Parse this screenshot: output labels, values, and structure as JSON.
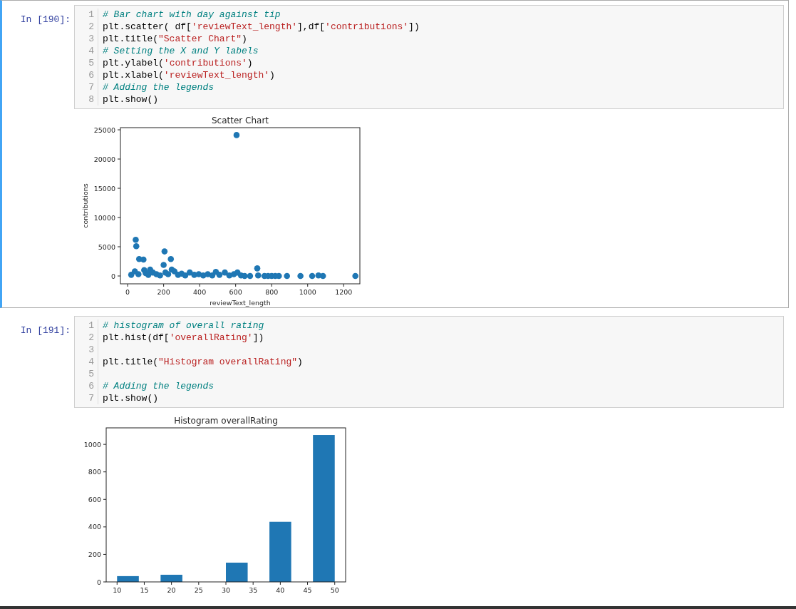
{
  "cells": [
    {
      "prompt": "In [190]:",
      "selected": true,
      "code": [
        {
          "number": "1",
          "tokens": [
            {
              "kind": "comment",
              "text": "# Bar chart with day against tip"
            }
          ]
        },
        {
          "number": "2",
          "tokens": [
            {
              "kind": "plain",
              "text": "plt.scatter( df["
            },
            {
              "kind": "string",
              "text": "'reviewText_length'"
            },
            {
              "kind": "plain",
              "text": "],df["
            },
            {
              "kind": "string",
              "text": "'contributions'"
            },
            {
              "kind": "plain",
              "text": "])"
            }
          ]
        },
        {
          "number": "3",
          "tokens": [
            {
              "kind": "plain",
              "text": "plt.title("
            },
            {
              "kind": "string",
              "text": "\"Scatter Chart\""
            },
            {
              "kind": "plain",
              "text": ")"
            }
          ]
        },
        {
          "number": "4",
          "tokens": [
            {
              "kind": "comment",
              "text": "# Setting the X and Y labels"
            }
          ]
        },
        {
          "number": "5",
          "tokens": [
            {
              "kind": "plain",
              "text": "plt.ylabel("
            },
            {
              "kind": "string",
              "text": "'contributions'"
            },
            {
              "kind": "plain",
              "text": ")"
            }
          ]
        },
        {
          "number": "6",
          "tokens": [
            {
              "kind": "plain",
              "text": "plt.xlabel("
            },
            {
              "kind": "string",
              "text": "'reviewText_length'"
            },
            {
              "kind": "plain",
              "text": ")"
            }
          ]
        },
        {
          "number": "7",
          "tokens": [
            {
              "kind": "comment",
              "text": "# Adding the legends"
            }
          ]
        },
        {
          "number": "8",
          "tokens": [
            {
              "kind": "plain",
              "text": "plt.show()"
            }
          ]
        }
      ],
      "output": {
        "chart_data": {
          "type": "scatter",
          "title": "Scatter Chart",
          "xlabel": "reviewText_length",
          "ylabel": "contributions",
          "xlim": [
            -40,
            1290
          ],
          "ylim": [
            -1340,
            25370
          ],
          "xticks": [
            0,
            200,
            400,
            600,
            800,
            1000,
            1200
          ],
          "yticks": [
            0,
            5000,
            10000,
            15000,
            20000,
            25000
          ],
          "x": [
            20,
            40,
            45,
            48,
            60,
            64,
            88,
            92,
            100,
            115,
            125,
            140,
            160,
            180,
            200,
            205,
            210,
            225,
            240,
            245,
            260,
            280,
            300,
            320,
            345,
            370,
            395,
            420,
            445,
            470,
            490,
            510,
            540,
            565,
            590,
            605,
            610,
            630,
            650,
            680,
            720,
            725,
            760,
            780,
            800,
            820,
            840,
            885,
            960,
            1025,
            1060,
            1085,
            1265
          ],
          "series": [
            {
              "color": "#1f77b4",
              "values": [
                200,
                800,
                6200,
                5100,
                300,
                2900,
                2800,
                1000,
                500,
                200,
                1100,
                600,
                300,
                100,
                1900,
                4200,
                600,
                300,
                2900,
                1100,
                800,
                200,
                400,
                100,
                600,
                200,
                300,
                100,
                300,
                100,
                700,
                200,
                600,
                100,
                300,
                24100,
                600,
                100,
                0,
                0,
                1300,
                100,
                0,
                0,
                0,
                0,
                0,
                0,
                0,
                0,
                100,
                0,
                0
              ]
            }
          ]
        }
      }
    },
    {
      "prompt": "In [191]:",
      "selected": false,
      "code": [
        {
          "number": "1",
          "tokens": [
            {
              "kind": "comment",
              "text": "# histogram of overall rating"
            }
          ]
        },
        {
          "number": "2",
          "tokens": [
            {
              "kind": "plain",
              "text": "plt.hist(df["
            },
            {
              "kind": "string",
              "text": "'overallRating'"
            },
            {
              "kind": "plain",
              "text": "])"
            }
          ]
        },
        {
          "number": "3"
        },
        {
          "number": "4",
          "tokens": [
            {
              "kind": "plain",
              "text": "plt.title("
            },
            {
              "kind": "string",
              "text": "\"Histogram overallRating\""
            },
            {
              "kind": "plain",
              "text": ")"
            }
          ]
        },
        {
          "number": "5"
        },
        {
          "number": "6",
          "tokens": [
            {
              "kind": "comment",
              "text": "# Adding the legends"
            }
          ]
        },
        {
          "number": "7",
          "tokens": [
            {
              "kind": "plain",
              "text": "plt.show()"
            }
          ]
        }
      ],
      "output": {
        "chart_data": {
          "type": "bar",
          "title": "Histogram overallRating",
          "xlim": [
            8,
            52
          ],
          "ylim": [
            0,
            1120
          ],
          "xticks": [
            10,
            15,
            20,
            25,
            30,
            35,
            40,
            45,
            50
          ],
          "yticks": [
            0,
            200,
            400,
            600,
            800,
            1000
          ],
          "x": [
            12,
            16,
            20,
            24,
            28,
            32,
            36,
            40,
            44,
            48
          ],
          "series": [
            {
              "color": "#1f77b4",
              "values": [
                42,
                0,
                52,
                0,
                0,
                140,
                0,
                437,
                0,
                1068
              ]
            }
          ]
        }
      }
    }
  ]
}
